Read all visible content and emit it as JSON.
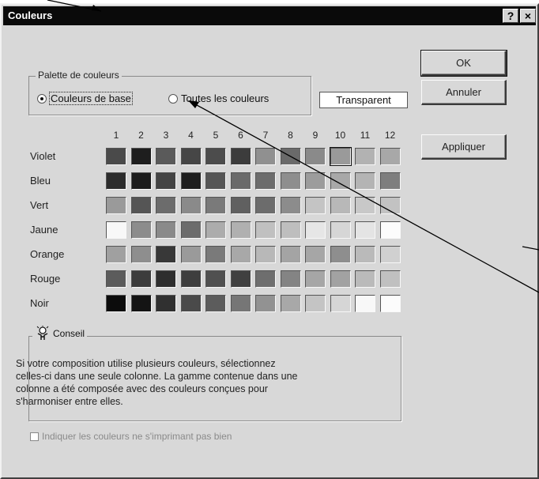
{
  "window": {
    "title": "Couleurs",
    "help_label": "?",
    "close_label": "×"
  },
  "buttons": {
    "ok": "OK",
    "cancel": "Annuler",
    "apply": "Appliquer"
  },
  "palette_group": {
    "legend": "Palette de couleurs",
    "options": [
      {
        "label": "Couleurs de base",
        "selected": true
      },
      {
        "label": "Toutes les couleurs",
        "selected": false
      }
    ],
    "transparent_label": "Transparent"
  },
  "grid": {
    "columns": [
      "1",
      "2",
      "3",
      "4",
      "5",
      "6",
      "7",
      "8",
      "9",
      "10",
      "11",
      "12"
    ],
    "rows": [
      {
        "label": "Violet",
        "colors": [
          "#4a4a4a",
          "#1e1e1e",
          "#5a5a5a",
          "#464646",
          "#4c4c4c",
          "#3c3c3c",
          "#909090",
          "#6a6a6a",
          "#8a8a8a",
          "#9a9a9a",
          "#b2b2b2",
          "#a8a8a8"
        ]
      },
      {
        "label": "Bleu",
        "colors": [
          "#2c2c2c",
          "#1c1c1c",
          "#444444",
          "#1e1e1e",
          "#555555",
          "#6a6a6a",
          "#6c6c6c",
          "#8e8e8e",
          "#9c9c9c",
          "#a8a8a8",
          "#b4b4b4",
          "#7e7e7e"
        ]
      },
      {
        "label": "Vert",
        "colors": [
          "#9a9a9a",
          "#555555",
          "#6c6c6c",
          "#8a8a8a",
          "#7a7a7a",
          "#606060",
          "#6c6c6c",
          "#8c8c8c",
          "#c4c4c4",
          "#b8b8b8",
          "#c8c8c8",
          "#c2c2c2"
        ]
      },
      {
        "label": "Jaune",
        "colors": [
          "#f8f8f8",
          "#8c8c8c",
          "#8a8a8a",
          "#6c6c6c",
          "#acacac",
          "#b0b0b0",
          "#c0c0c0",
          "#bebebe",
          "#e6e6e6",
          "#d6d6d6",
          "#e4e4e4",
          "#fcfcfc"
        ]
      },
      {
        "label": "Orange",
        "colors": [
          "#a0a0a0",
          "#8e8e8e",
          "#383838",
          "#9a9a9a",
          "#7a7a7a",
          "#a8a8a8",
          "#b8b8b8",
          "#a4a4a4",
          "#a6a6a6",
          "#8e8e8e",
          "#bababa",
          "#d0d0d0"
        ]
      },
      {
        "label": "Rouge",
        "colors": [
          "#5c5c5c",
          "#3c3c3c",
          "#2e2e2e",
          "#3e3e3e",
          "#505050",
          "#404040",
          "#6e6e6e",
          "#848484",
          "#a6a6a6",
          "#a2a2a2",
          "#bababa",
          "#c0c0c0"
        ]
      },
      {
        "label": "Noir",
        "colors": [
          "#0c0c0c",
          "#141414",
          "#303030",
          "#4a4a4a",
          "#5c5c5c",
          "#767676",
          "#929292",
          "#a8a8a8",
          "#c4c4c4",
          "#d6d6d6",
          "#f8f8f8",
          "#fcfcfc"
        ]
      }
    ]
  },
  "tip": {
    "heading": "Conseil",
    "icon": "lightbulb-person-icon",
    "lines": [
      "Si votre composition utilise plusieurs couleurs, sélectionnez",
      "celles-ci dans une seule colonne. La gamme contenue dans une",
      "colonne a été composée avec des couleurs conçues pour",
      "s'harmoniser entre elles."
    ]
  },
  "option_checkbox": {
    "label": "Indiquer les couleurs ne s'imprimant pas bien",
    "checked": false,
    "disabled": true
  },
  "colors": {
    "title_bar": "#0a0a0a",
    "dialog_bg": "#d8d8d8"
  }
}
